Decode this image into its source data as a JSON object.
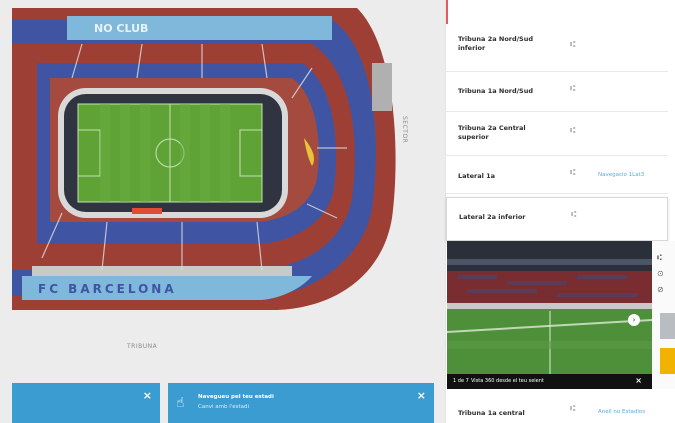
{
  "map": {
    "sector_label": "SECTOR",
    "tribuna_label": "TRIBUNA",
    "top_banner_text": "NO CLUB",
    "bottom_banner_text": "FC BARCELONA"
  },
  "notices": {
    "left_close": "×",
    "right_title": "Navegueu pel teu estadi",
    "right_sub": "Canvi amb l'estadi",
    "right_close": "×",
    "hand_icon": "☝"
  },
  "seat_list": [
    {
      "name": "Tribuna 2a Nord/Sud inferior",
      "seat_icon": "⑆",
      "action": ""
    },
    {
      "name": "Tribuna 1a Nord/Sud",
      "seat_icon": "⑆",
      "action": ""
    },
    {
      "name": "Tribuna 2a Central superior",
      "seat_icon": "⑆",
      "action": ""
    },
    {
      "name": "Lateral 1a",
      "seat_icon": "⑆",
      "action": "Navegacio 1Lat3"
    },
    {
      "name": "Lateral 2a inferior",
      "seat_icon": "⑆",
      "action": ""
    },
    {
      "name": "Tribuna 1a central",
      "seat_icon": "⑆",
      "action": "Anell no Estadios"
    }
  ],
  "view_from_seat": {
    "counter": "1 de 7",
    "caption": "Vista 360 desde el teu seient",
    "close": "×",
    "next": "›"
  },
  "side_strip": {
    "icon_1": "⑆",
    "icon_2": "⊙",
    "icon_3": "⊘"
  },
  "colors": {
    "accent": "#3b9cd1",
    "seat_red": "#9e3f36",
    "seat_blue": "#3f55a4",
    "pitch_green": "#5fa236",
    "highlight_yellow": "#f2b200"
  }
}
